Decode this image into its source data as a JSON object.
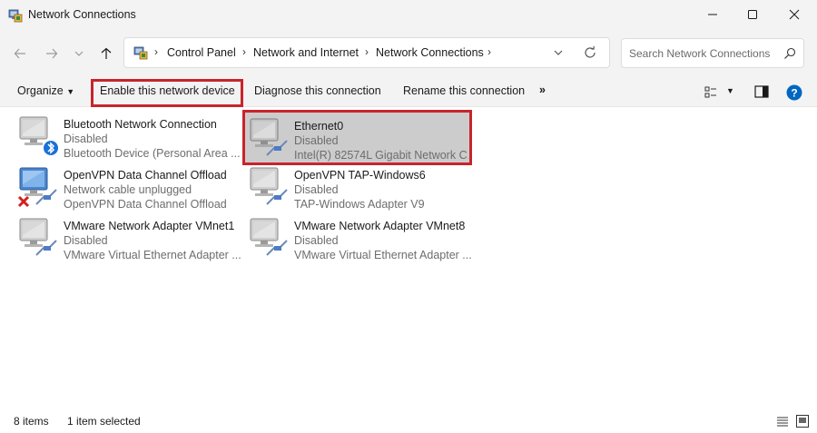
{
  "window": {
    "title": "Network Connections",
    "minimize_icon": "minimize-icon",
    "maximize_icon": "maximize-icon",
    "close_icon": "close-icon"
  },
  "address": {
    "crumbs": [
      "Control Panel",
      "Network and Internet",
      "Network Connections"
    ],
    "search_placeholder": "Search Network Connections"
  },
  "commands": {
    "organize": "Organize",
    "enable": "Enable this network device",
    "diagnose": "Diagnose this connection",
    "rename": "Rename this connection",
    "more": "»"
  },
  "items": [
    {
      "name": "Bluetooth Network Connection",
      "status": "Disabled",
      "device": "Bluetooth Device (Personal Area ...",
      "badge": "bluetooth",
      "selected": false
    },
    {
      "name": "Ethernet0",
      "status": "Disabled",
      "device": "Intel(R) 82574L Gigabit Network C...",
      "badge": "cable",
      "selected": true
    },
    {
      "name": "OpenVPN Data Channel Offload",
      "status": "Network cable unplugged",
      "device": "OpenVPN Data Channel Offload",
      "badge": "red-x",
      "selected": false
    },
    {
      "name": "OpenVPN TAP-Windows6",
      "status": "Disabled",
      "device": "TAP-Windows Adapter V9",
      "badge": "cable",
      "selected": false
    },
    {
      "name": "VMware Network Adapter VMnet1",
      "status": "Disabled",
      "device": "VMware Virtual Ethernet Adapter ...",
      "badge": "cable",
      "selected": false
    },
    {
      "name": "VMware Network Adapter VMnet8",
      "status": "Disabled",
      "device": "VMware Virtual Ethernet Adapter ...",
      "badge": "cable",
      "selected": false
    }
  ],
  "status": {
    "count": "8 items",
    "selection": "1 item selected"
  },
  "colors": {
    "highlight": "#c8242c",
    "selection": "#cccccc",
    "help": "#0067c0"
  }
}
